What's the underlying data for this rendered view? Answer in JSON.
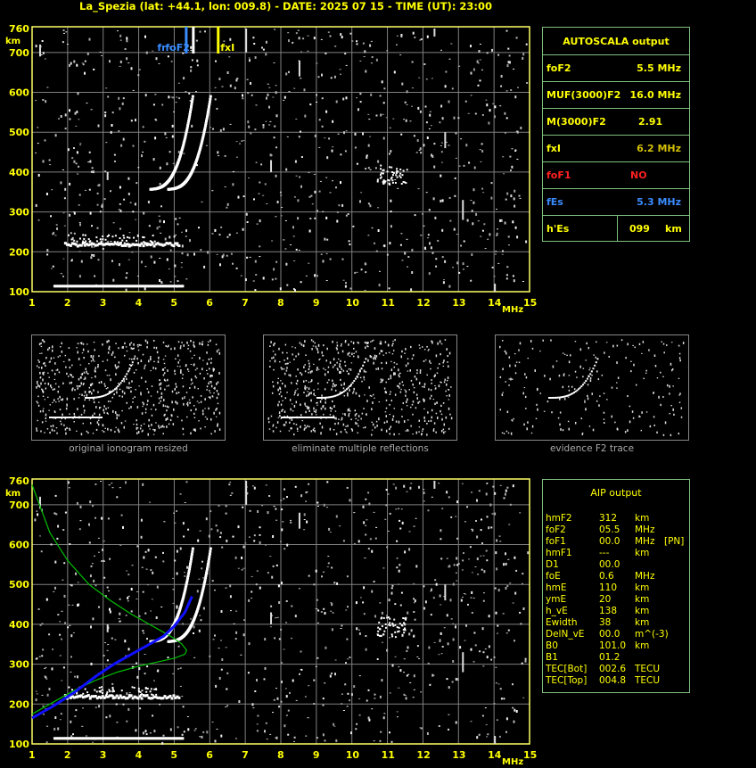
{
  "header": {
    "title": "La_Spezia (lat: +44.1, lon: 009.8) - DATE: 2025 07 15 - TIME (UT): 23:00"
  },
  "axes": {
    "y_unit": "km",
    "x_unit": "MHz",
    "y_ticks": [
      "760",
      "700",
      "600",
      "500",
      "400",
      "300",
      "200",
      "100"
    ],
    "x_ticks": [
      "1",
      "2",
      "3",
      "4",
      "5",
      "6",
      "7",
      "8",
      "9",
      "10",
      "11",
      "12",
      "13",
      "14",
      "15"
    ]
  },
  "markers": {
    "foF2": "foF2",
    "fxI": "fxI",
    "fr": "fr"
  },
  "autoscala": {
    "title": "AUTOSCALA output",
    "rows": [
      {
        "label": "foF2",
        "value": "5.5 MHz",
        "color": "#ffff00"
      },
      {
        "label": "MUF(3000)F2",
        "value": "16.0 MHz",
        "color": "#ffff00"
      },
      {
        "label": "M(3000)F2",
        "value": "2.91",
        "color": "#ffff00"
      },
      {
        "label": "fxI",
        "value": "6.2 MHz",
        "color": "#ffff00",
        "value_color": "#d4c000"
      },
      {
        "label": "foF1",
        "value": "NO",
        "color": "#ff2020"
      },
      {
        "label": "fEs",
        "value": "5.3 MHz",
        "color": "#3a8cff"
      },
      {
        "label": "h'Es",
        "value": "099",
        "unit": "km",
        "color": "#ffff00"
      }
    ]
  },
  "thumbnails": [
    {
      "caption": "original ionogram resized"
    },
    {
      "caption": "eliminate multiple reflections"
    },
    {
      "caption": "evidence F2 trace"
    }
  ],
  "aip": {
    "title": "AIP output",
    "rows": [
      {
        "k": "hmF2",
        "v": "312",
        "u": "km",
        "x": ""
      },
      {
        "k": "foF2",
        "v": "05.5",
        "u": "MHz",
        "x": ""
      },
      {
        "k": "foF1",
        "v": "00.0",
        "u": "MHz",
        "x": "[PN]"
      },
      {
        "k": "hmF1",
        "v": "---",
        "u": "km",
        "x": ""
      },
      {
        "k": "D1",
        "v": "00.0",
        "u": "",
        "x": ""
      },
      {
        "k": "foE",
        "v": "0.6",
        "u": "MHz",
        "x": ""
      },
      {
        "k": "hmE",
        "v": "110",
        "u": "km",
        "x": ""
      },
      {
        "k": "ymE",
        "v": "20",
        "u": "km",
        "x": ""
      },
      {
        "k": "h_vE",
        "v": "138",
        "u": "km",
        "x": ""
      },
      {
        "k": "Ewidth",
        "v": "38",
        "u": "km",
        "x": ""
      },
      {
        "k": "DelN_vE",
        "v": "00.0",
        "u": "m^(-3)",
        "x": ""
      },
      {
        "k": "B0",
        "v": "101.0",
        "u": "km",
        "x": ""
      },
      {
        "k": "B1",
        "v": "01.2",
        "u": "",
        "x": ""
      },
      {
        "k": "TEC[Bot]",
        "v": "002.6",
        "u": "TECU",
        "x": ""
      },
      {
        "k": "TEC[Top]",
        "v": "004.8",
        "u": "TECU",
        "x": ""
      }
    ]
  },
  "colors": {
    "axis": "#ffff66",
    "grid": "#808080",
    "panel_border": "#7fbf7f",
    "profile": "#1010ff",
    "model": "#00c000"
  }
}
